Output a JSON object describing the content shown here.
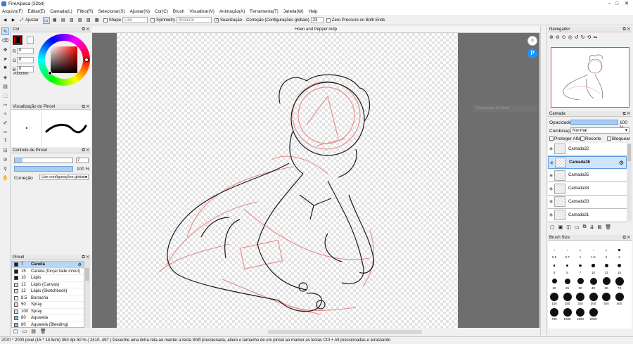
{
  "window": {
    "title": "FireAlpaca (32bit)"
  },
  "menu": [
    "Arquivo(F)",
    "Editar(E)",
    "Camada(L)",
    "Filtro(R)",
    "Selecionar(S)",
    "Ajustar(N)",
    "Cor(C)",
    "Brush",
    "Visualizar(V)",
    "Animação(A)",
    "Ferramenta(T)",
    "Janela(W)",
    "Help"
  ],
  "toolbar": {
    "adjust": "Ajustar",
    "shape": "Shape",
    "shape_value": "Line",
    "symmetry": "Symmetry",
    "symmetry_value": "Bilateral",
    "smoothing": "Suavização",
    "correction": "Correção (Configurações globais)",
    "correction_value": "23",
    "zero_pressure": "Zero Pressure on Both Ends"
  },
  "document": {
    "tab": "Hoen and Pepper.mdp"
  },
  "color_panel": {
    "title": "Cor",
    "r_label": "R",
    "g_label": "G",
    "b_label": "B",
    "r": "0",
    "g": "0",
    "b": "0",
    "hex": "#000000"
  },
  "brush_preview": {
    "title": "Visualização do Pincel"
  },
  "brush_control": {
    "title": "Controle de Pincel",
    "size": "7",
    "opacity": "100 %",
    "correction_label": "Correção",
    "correction_value": "Use configurações globais"
  },
  "brush_panel": {
    "title": "Pincel",
    "items": [
      {
        "size": "7",
        "name": "Caneta",
        "color": "#1a1a1a"
      },
      {
        "size": "15",
        "name": "Caneta (forçar fade in/out)",
        "color": "#1a1a1a"
      },
      {
        "size": "10",
        "name": "Lápis",
        "color": "#1a1a1a"
      },
      {
        "size": "12",
        "name": "Lápis (Canvas)",
        "color": "#dddddd"
      },
      {
        "size": "12",
        "name": "Lápis (Sketchbook)",
        "color": "#dddddd"
      },
      {
        "size": "8.5",
        "name": "Borracha",
        "color": "#ffffff"
      },
      {
        "size": "50",
        "name": "Spray",
        "color": "#dddddd"
      },
      {
        "size": "100",
        "name": "Spray",
        "color": "#dddddd"
      },
      {
        "size": "80",
        "name": "Aquarela",
        "color": "#7ec6ee"
      },
      {
        "size": "80",
        "name": "Aquarela (Bleeding)",
        "color": "#7ec6ee"
      }
    ]
  },
  "navigator": {
    "title": "Navegador",
    "float_label": "Espessura de linha"
  },
  "layer_panel": {
    "title": "Camada",
    "opacity_label": "Opacidade",
    "opacity_value": "100 %",
    "opacity_fraction": 1.0,
    "blend_label": "Combinação",
    "blend_value": "Normal",
    "protect_alpha": "Proteger Alfa",
    "clipping": "Recorte",
    "lock": "Bloquear",
    "layers": [
      {
        "name": "Camada32"
      },
      {
        "name": "Camada36"
      },
      {
        "name": "Camada35"
      },
      {
        "name": "Camada34"
      },
      {
        "name": "Camada33"
      },
      {
        "name": "Camada31"
      }
    ],
    "active_index": 1
  },
  "brush_size": {
    "title": "Brush Size",
    "values": [
      "0.5",
      "0.7",
      "1",
      "1.5",
      "2",
      "3",
      "4",
      "5",
      "7",
      "10",
      "13",
      "15",
      "20",
      "25",
      "30",
      "40",
      "50",
      "70",
      "100",
      "150",
      "200",
      "300",
      "400",
      "500",
      "700",
      "1000",
      "1500",
      "2000"
    ]
  },
  "status": {
    "text": "2070 * 2000 pixel  (15 * 14.5cm)  350 dpi  50 %  ( 2410, 497 )  Desenhe uma linha reta ao manter a tecla Shift pressionada, altere o tamanho de um pincel ao manter as teclas Ctrl + Alt pressionadas e arrastando"
  },
  "colors": {
    "accent": "#5b9be0",
    "canvas_bg": "#6e6e6e",
    "sketch_red": "#e58a8a"
  }
}
